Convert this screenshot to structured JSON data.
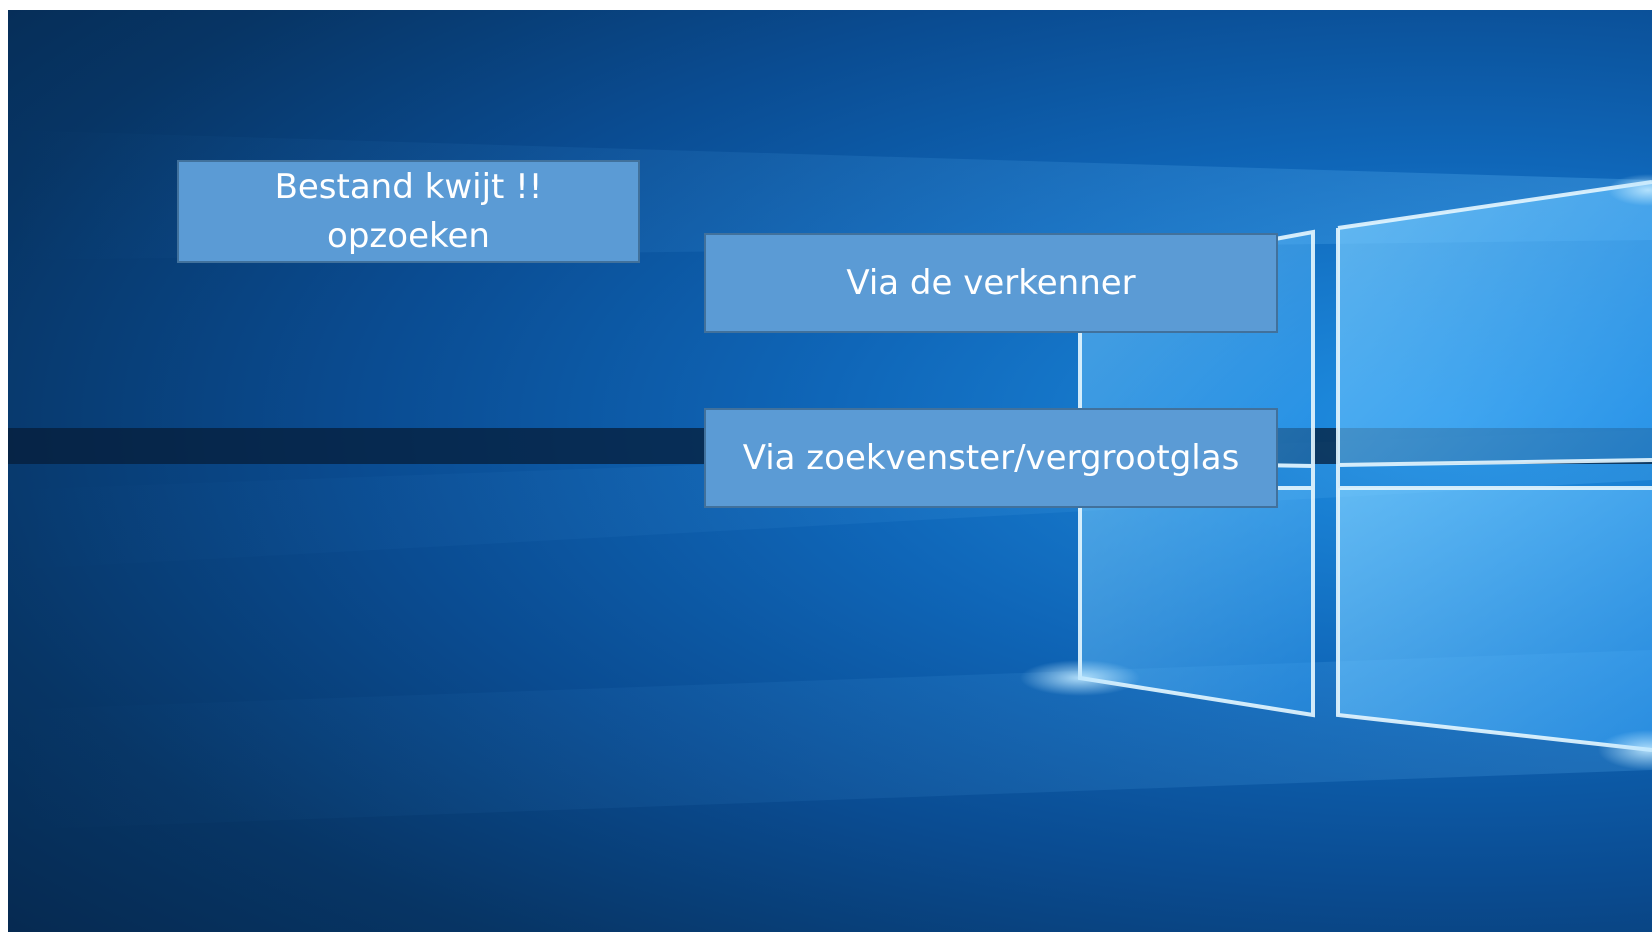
{
  "slide": {
    "theme": "windows-10-wallpaper",
    "colors": {
      "box_fill": "#5b9bd5",
      "box_border": "#41719c",
      "box_text": "#ffffff"
    }
  },
  "boxes": {
    "main": {
      "line1": "Bestand kwijt !!",
      "line2": "opzoeken"
    },
    "option1": {
      "label": "Via de verkenner"
    },
    "option2": {
      "label": "Via zoekvenster/vergrootglas"
    }
  }
}
